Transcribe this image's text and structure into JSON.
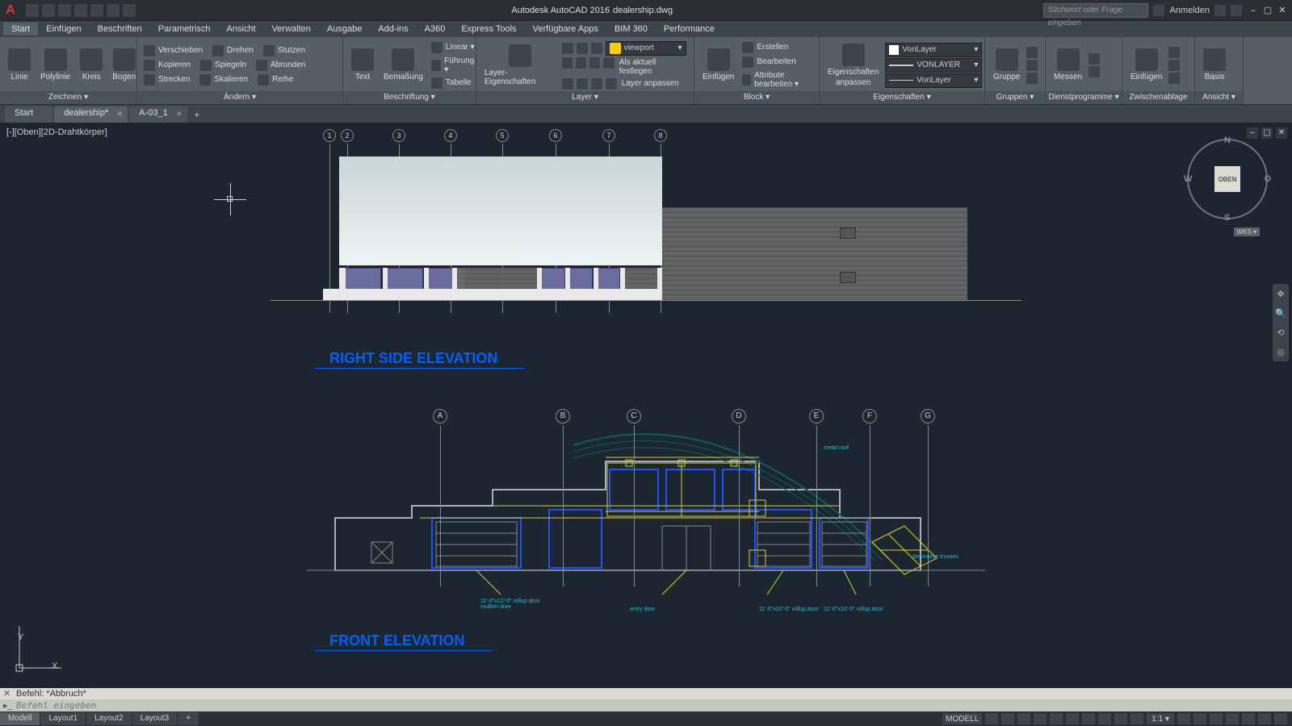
{
  "app": {
    "title_left": "Autodesk AutoCAD 2016",
    "title_right": "dealership.dwg"
  },
  "search": {
    "placeholder": "Stichwort oder Frage eingeben"
  },
  "signin": "Anmelden",
  "menu": [
    "Start",
    "Einfügen",
    "Beschriften",
    "Parametrisch",
    "Ansicht",
    "Verwalten",
    "Ausgabe",
    "Add-ins",
    "A360",
    "Express Tools",
    "Verfügbare Apps",
    "BIM 360",
    "Performance"
  ],
  "ribbon": {
    "draw": {
      "items": [
        "Linie",
        "Polylinie",
        "Kreis",
        "Bogen"
      ],
      "title": "Zeichnen ▾"
    },
    "modify": {
      "rows": [
        [
          "Verschieben",
          "Drehen",
          "Stutzen"
        ],
        [
          "Kopieren",
          "Spiegeln",
          "Abrunden"
        ],
        [
          "Strecken",
          "Skalieren",
          "Reihe"
        ]
      ],
      "title": "Ändern ▾"
    },
    "anno": {
      "big": [
        "Text",
        "Bemaßung"
      ],
      "rows": [
        "Linear ▾",
        "Führung ▾",
        "Tabelle"
      ],
      "title": "Beschriftung ▾"
    },
    "layers": {
      "big": "Layer-Eigenschaften",
      "rows": [
        "Als aktuell festlegen",
        "Layer anpassen"
      ],
      "dropdown": "viewport",
      "title": "Layer ▾"
    },
    "block": {
      "big": "Einfügen",
      "rows": [
        "Erstellen",
        "Bearbeiten",
        "Attribute bearbeiten ▾"
      ],
      "title": "Block ▾"
    },
    "props": {
      "big": [
        "Eigenschaften",
        "anpassen"
      ],
      "slot1": "VonLayer",
      "slot2": "VONLAYER",
      "slot3": "VonLayer",
      "title": "Eigenschaften ▾"
    },
    "groups": {
      "big": "Gruppe",
      "title": "Gruppen ▾"
    },
    "util": {
      "big": "Messen",
      "title": "Dienstprogramme ▾"
    },
    "clip": {
      "big": "Einfügen",
      "title": "Zwischenablage"
    },
    "view": {
      "big": "Basis",
      "title": "Ansicht ▾"
    }
  },
  "filetabs": {
    "items": [
      "Start",
      "dealership*",
      "A-03_1"
    ],
    "active": 1
  },
  "viewport": {
    "label": "[-][Oben][2D-Drahtkörper]",
    "cube": "OBEN",
    "wks": "WKS ▾"
  },
  "drawing": {
    "elev1": {
      "title": "RIGHT SIDE ELEVATION",
      "grids": [
        "1",
        "2",
        "3",
        "4",
        "5",
        "6",
        "7",
        "8"
      ]
    },
    "elev2": {
      "title": "FRONT ELEVATION",
      "grids": [
        "A",
        "B",
        "C",
        "D",
        "E",
        "F",
        "G"
      ],
      "labels": {
        "metal_roof": "metal roof",
        "entry": "entry door",
        "rollup1": "11'-0\"x12'-0\" rollup door\nmullion door",
        "rollup2": "11'-0\"x10'-0\" rollup door",
        "rollup3": "11'-0\"x10'-0\" rollup door",
        "decor": "decorative trusses"
      }
    }
  },
  "cmd": {
    "hist": "Befehl: *Abbruch*",
    "placeholder": "Befehl eingeben"
  },
  "modeltabs": [
    "Modell",
    "Layout1",
    "Layout2",
    "Layout3"
  ],
  "status": {
    "model": "MODELL",
    "scale": "1:1 ▾"
  },
  "chart_data": null
}
